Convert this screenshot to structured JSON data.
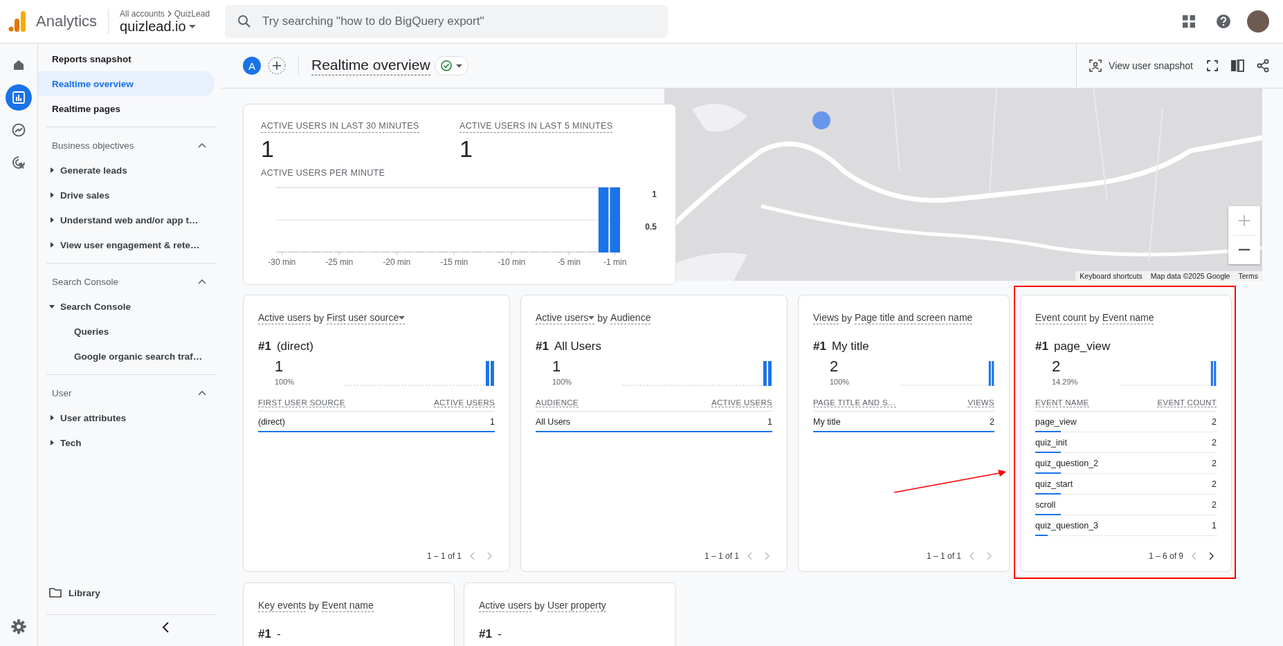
{
  "top_bar": {
    "product": "Analytics",
    "breadcrumb": [
      "All accounts",
      "QuizLead"
    ],
    "property": "quizlead.io",
    "search": {
      "placeholder": "Try searching \"how to do BigQuery export\""
    }
  },
  "rail": [
    {
      "kind": "home",
      "selected": false
    },
    {
      "kind": "reports",
      "selected": true
    },
    {
      "kind": "explore",
      "selected": false
    },
    {
      "kind": "advertising",
      "selected": false
    }
  ],
  "nav": [
    {
      "kind": "link",
      "label": "Reports snapshot",
      "selected": false
    },
    {
      "kind": "link",
      "label": "Realtime overview",
      "selected": true
    },
    {
      "kind": "link",
      "label": "Realtime pages",
      "selected": false
    },
    {
      "kind": "section",
      "label": "Business objectives",
      "expanded": true,
      "children": [
        {
          "label": "Generate leads",
          "expanded": false
        },
        {
          "label": "Drive sales",
          "expanded": false
        },
        {
          "label": "Understand web and/or app t…",
          "expanded": false
        },
        {
          "label": "View user engagement & rete…",
          "expanded": false
        }
      ]
    },
    {
      "kind": "section",
      "label": "Search Console",
      "expanded": true,
      "children": [
        {
          "label": "Search Console",
          "expanded": true,
          "children": [
            {
              "label": "Queries"
            },
            {
              "label": "Google organic search traf…"
            }
          ]
        }
      ]
    },
    {
      "kind": "section",
      "label": "User",
      "expanded": true,
      "children": [
        {
          "label": "User attributes",
          "expanded": false
        },
        {
          "label": "Tech",
          "expanded": false
        }
      ]
    }
  ],
  "library": "Library",
  "header": {
    "avatar": "A",
    "title": "Realtime overview",
    "snapshot_button": "View user snapshot"
  },
  "summary_card": {
    "metrics": [
      {
        "label": "ACTIVE USERS IN LAST 30 MINUTES",
        "value": "1"
      },
      {
        "label": "ACTIVE USERS IN LAST 5 MINUTES",
        "value": "1"
      }
    ],
    "chart_title": "ACTIVE USERS PER MINUTE",
    "chart_data": {
      "type": "bar",
      "x": [
        -30,
        -29,
        -28,
        -27,
        -26,
        -25,
        -24,
        -23,
        -22,
        -21,
        -20,
        -19,
        -18,
        -17,
        -16,
        -15,
        -14,
        -13,
        -12,
        -11,
        -10,
        -9,
        -8,
        -7,
        -6,
        -5,
        -4,
        -3,
        -2,
        -1
      ],
      "values": [
        0,
        0,
        0,
        0,
        0,
        0,
        0,
        0,
        0,
        0,
        0,
        0,
        0,
        0,
        0,
        0,
        0,
        0,
        0,
        0,
        0,
        0,
        0,
        0,
        0,
        0,
        0,
        0,
        1,
        1
      ],
      "xlim": [
        -30.5,
        -0.5
      ],
      "ylim": [
        0,
        1
      ],
      "yticks": [
        0.5,
        1
      ],
      "xticks": [
        {
          "value": -30,
          "label": "-30 min"
        },
        {
          "value": -25,
          "label": "-25 min"
        },
        {
          "value": -20,
          "label": "-20 min"
        },
        {
          "value": -15,
          "label": "-15 min"
        },
        {
          "value": -10,
          "label": "-10 min"
        },
        {
          "value": -5,
          "label": "-5 min"
        },
        {
          "value": -1,
          "label": "-1 min"
        }
      ]
    }
  },
  "map": {
    "footer": [
      "Keyboard shortcuts",
      "Map data ©2025 Google",
      "Terms"
    ]
  },
  "cards": [
    {
      "metric": "Active users",
      "metric_menu": false,
      "by": "by",
      "dimension": "First user source",
      "dimension_menu": true,
      "rank": "#1",
      "top_name": "(direct)",
      "top_value": "1",
      "top_share": "100%",
      "columns": [
        "FIRST USER SOURCE",
        "ACTIVE USERS"
      ],
      "rows": [
        {
          "name": "(direct)",
          "value": "1",
          "level": 1
        }
      ],
      "pagination": "1 – 1 of 1",
      "next_enabled": false,
      "highlighted": false
    },
    {
      "metric": "Active users",
      "metric_menu": true,
      "by": "by",
      "dimension": "Audience",
      "dimension_menu": false,
      "rank": "#1",
      "top_name": "All Users",
      "top_value": "1",
      "top_share": "100%",
      "columns": [
        "AUDIENCE",
        "ACTIVE USERS"
      ],
      "rows": [
        {
          "name": "All Users",
          "value": "1",
          "level": 1
        }
      ],
      "pagination": "1 – 1 of 1",
      "next_enabled": false,
      "highlighted": false
    },
    {
      "metric": "Views",
      "metric_menu": false,
      "by": "by",
      "dimension": "Page title and screen name",
      "dimension_menu": false,
      "rank": "#1",
      "top_name": "My title",
      "top_value": "2",
      "top_share": "100%",
      "columns": [
        "PAGE TITLE AND S…",
        "VIEWS"
      ],
      "rows": [
        {
          "name": "My title",
          "value": "2",
          "level": 1
        }
      ],
      "pagination": "1 – 1 of 1",
      "next_enabled": false,
      "highlighted": false
    },
    {
      "metric": "Event count",
      "metric_menu": false,
      "by": "by",
      "dimension": "Event name",
      "dimension_menu": false,
      "rank": "#1",
      "top_name": "page_view",
      "top_value": "2",
      "top_share": "14.29%",
      "columns": [
        "EVENT NAME",
        "EVENT COUNT"
      ],
      "rows": [
        {
          "name": "page_view",
          "value": "2",
          "level": 0.14
        },
        {
          "name": "quiz_init",
          "value": "2",
          "level": 0.14
        },
        {
          "name": "quiz_question_2",
          "value": "2",
          "level": 0.14
        },
        {
          "name": "quiz_start",
          "value": "2",
          "level": 0.14
        },
        {
          "name": "scroll",
          "value": "2",
          "level": 0.14
        },
        {
          "name": "quiz_question_3",
          "value": "1",
          "level": 0.07
        }
      ],
      "pagination": "1 – 6 of 9",
      "next_enabled": true,
      "highlighted": true
    }
  ],
  "bottom_cards": [
    {
      "metric": "Key events",
      "by": "by",
      "dimension": "Event name",
      "rank": "#1",
      "top_name": "-"
    },
    {
      "metric": "Active users",
      "by": "by",
      "dimension": "User property",
      "rank": "#1",
      "top_name": "-"
    }
  ]
}
